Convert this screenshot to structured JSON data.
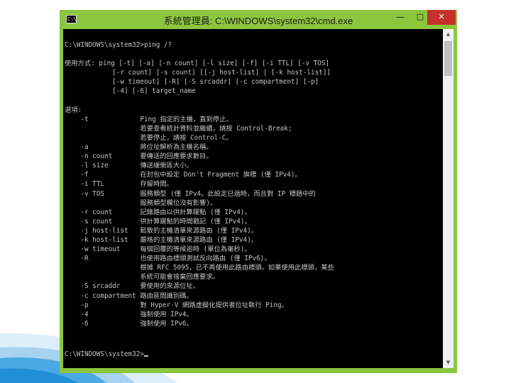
{
  "window": {
    "title": "系統管理員: C:\\WINDOWS\\system32\\cmd.exe",
    "icon_text": "C:\\",
    "min_glyph": "—",
    "max_glyph": "□",
    "close_glyph": "✕"
  },
  "console": {
    "lines": [
      "C:\\WINDOWS\\system32>ping /?",
      "",
      "使用方式: ping [-t] [-a] [-n count] [-l size] [-f] [-i TTL] [-v TOS]",
      "            [-r count] [-s count] [[-j host-list] | [-k host-list]]",
      "            [-w timeout] [-R] [-S srcaddr] [-c compartment] [-p]",
      "            [-4] [-6] target_name",
      "",
      "選項:",
      "    -t             Ping 指定的主機，直到停止。",
      "                   若要查看統計資料並繼續，請按 Control-Break;",
      "                   若要停止，請按 Control-C。",
      "    -a             將位址解析為主機名稱。",
      "    -n count       要傳送的回應要求數目。",
      "    -l size        傳送緩衝區大小。",
      "    -f             在封包中設定 Don't Fragment 旗標 (僅 IPv4)。",
      "    -i TTL         存留時間。",
      "    -v TOS         服務類型 (僅 IPv4。此設定已過時，而且對 IP 標題中的",
      "                   服務類型欄位沒有影響)。",
      "    -r count       記錄路由以供計算躍點 (僅 IPv4)。",
      "    -s count       供計算躍點的時間戳記 (僅 IPv4)。",
      "    -j host-list   鬆散的主機清單來源路由 (僅 IPv4)。",
      "    -k host-list   嚴格的主機清單來源路由 (僅 IPv4)。",
      "    -w timeout     每個回覆的等候逾時 (單位為毫秒)。",
      "    -R             也使用路由標頭測試反向路由 (僅 IPv6)。",
      "                   根據 RFC 5095，已不再使用此路由標頭。如果使用此標頭，某些",
      "                   系統可能會捨棄回應要求。",
      "    -S srcaddr     要使用的來源位址。",
      "    -c compartment 路由區間識別碼。",
      "    -p             對 Hyper-V 網路虛擬化提供者位址執行 Ping。",
      "    -4             強制使用 IPv4。",
      "    -6             強制使用 IPv6。"
    ],
    "prompt": "C:\\WINDOWS\\system32>"
  },
  "colors": {
    "window_frame": "#8cc63f",
    "console_bg": "#000000",
    "console_text": "#c4c4c4",
    "close_button": "#c7312b",
    "deco_blue": "#1f8fd6"
  }
}
